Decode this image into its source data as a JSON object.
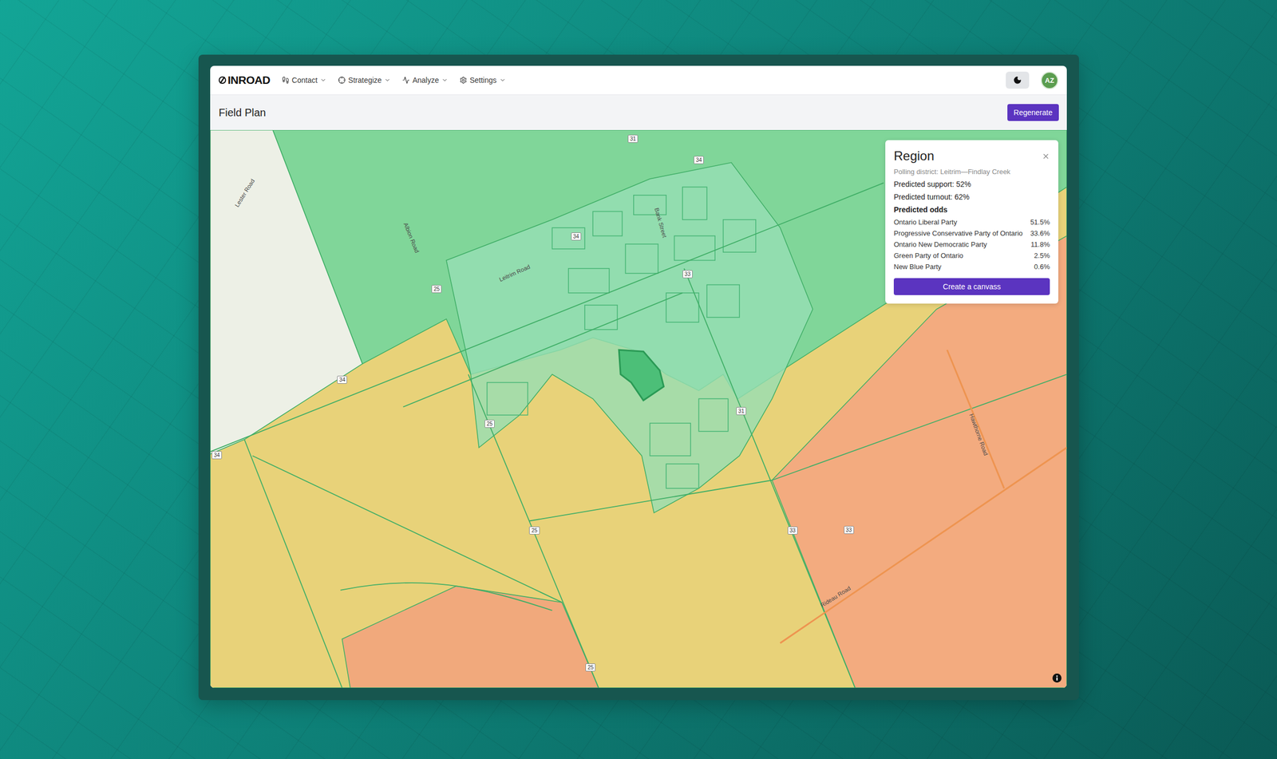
{
  "app": {
    "logo": "INROAD",
    "nav": [
      {
        "label": "Contact"
      },
      {
        "label": "Strategize"
      },
      {
        "label": "Analyze"
      },
      {
        "label": "Settings"
      }
    ],
    "avatar": "AZ"
  },
  "page": {
    "title": "Field Plan",
    "action": "Regenerate"
  },
  "map": {
    "districts": [
      {
        "color": "#e8d279",
        "selected": false
      },
      {
        "color": "#edf0e6",
        "selected": false
      },
      {
        "color": "#80d699",
        "selected": false
      },
      {
        "color": "#96dfb4",
        "selected": false
      },
      {
        "color": "#f3ab7f",
        "selected": false
      },
      {
        "color": "#f1a97c",
        "selected": false
      },
      {
        "color": "#4cbf78",
        "selected": true
      }
    ],
    "road_markers": [
      "31",
      "34",
      "34",
      "25",
      "34",
      "33",
      "25",
      "25",
      "33",
      "25",
      "33",
      "34",
      "31"
    ],
    "road_labels": [
      "Lester Road",
      "Albion Road",
      "Leitrim Road",
      "Bank Street",
      "Hawthorne Road",
      "Rideau Road"
    ]
  },
  "panel": {
    "title": "Region",
    "district": "Polling district: Leitrim—Findlay Creek",
    "support": "Predicted support: 52%",
    "turnout": "Predicted turnout: 62%",
    "odds_title": "Predicted odds",
    "odds": [
      {
        "party": "Ontario Liberal Party",
        "value": "51.5%"
      },
      {
        "party": "Progressive Conservative Party of Ontario",
        "value": "33.6%"
      },
      {
        "party": "Ontario New Democratic Party",
        "value": "11.8%"
      },
      {
        "party": "Green Party of Ontario",
        "value": "2.5%"
      },
      {
        "party": "New Blue Party",
        "value": "0.6%"
      }
    ],
    "button": "Create a canvass"
  }
}
